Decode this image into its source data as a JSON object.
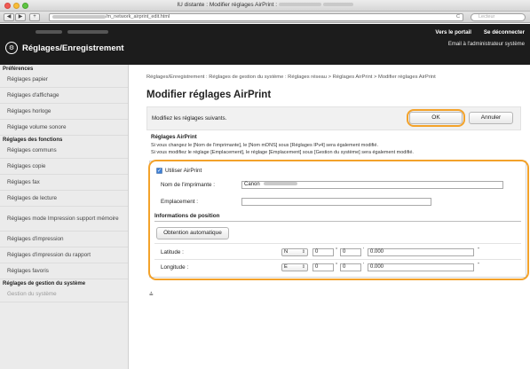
{
  "window": {
    "title_prefix": "IU distante : Modifier réglages AirPrint :",
    "address": "/m_network_airprint_edit.html",
    "reload_icon": "C",
    "search_placeholder": "Lecteur",
    "back_icon": "◀",
    "forward_icon": "▶",
    "add_icon": "+"
  },
  "header": {
    "portal_link": "Vers le portail",
    "logout_link": "Se déconnecter",
    "email_link": "Email à l'administrateur système",
    "app_title": "Réglages/Enregistrement",
    "app_icon": "⚙"
  },
  "sidebar": {
    "sections": [
      {
        "heading": "Préférences",
        "items": [
          {
            "label": "Réglages papier",
            "height": 18
          },
          {
            "label": "Réglages d'affichage",
            "height": 18
          },
          {
            "label": "Réglages horloge",
            "height": 18
          },
          {
            "label": "Réglage volume sonore",
            "height": 18
          }
        ]
      },
      {
        "heading": "Réglages des fonctions",
        "items": [
          {
            "label": "Réglages communs",
            "height": 18
          },
          {
            "label": "Réglages copie",
            "height": 18
          },
          {
            "label": "Réglages fax",
            "height": 18
          },
          {
            "label": "Réglages de lecture",
            "height": 18
          },
          {
            "label": "Réglages mode Impression support mémoire",
            "height": 28
          },
          {
            "label": "Réglages d'impression",
            "height": 18
          },
          {
            "label": "Réglages d'impression du rapport",
            "height": 18
          },
          {
            "label": "Réglages favoris",
            "height": 18
          }
        ]
      },
      {
        "heading": "Réglages de gestion du système",
        "items": [
          {
            "label": "Gestion du système",
            "height": 18,
            "dim": true
          }
        ]
      }
    ]
  },
  "main": {
    "breadcrumb": "Réglages/Enregistrement : Réglages de gestion du système : Réglages réseau > Réglages AirPrint > Modifier réglages AirPrint",
    "title": "Modifier réglages AirPrint",
    "prompt": "Modifiez les réglages suivants.",
    "ok_label": "OK",
    "cancel_label": "Annuler",
    "section_title": "Réglages AirPrint",
    "note1": "Si vous changez le [Nom de l'imprimante], le [Nom mDNS] sous [Réglages IPv4] sera également modifié.",
    "note2": "Si vous modifiez le réglage [Emplacement], le réglage [Emplacement] sous [Gestion du système] sera également modifié.",
    "use_airprint_label": "Utiliser AirPrint",
    "use_airprint_checked": true,
    "printer_name_label": "Nom de l'imprimante :",
    "printer_name_value": "Canon",
    "location_label": "Emplacement :",
    "location_value": "",
    "position_heading": "Informations de position",
    "auto_btn_label": "Obtention automatique",
    "latitude": {
      "label": "Latitude :",
      "hemisphere": "N",
      "degrees": "0",
      "minutes": "0",
      "seconds": "0.000",
      "deg_unit": "°",
      "min_unit": "'",
      "sec_unit": "\""
    },
    "longitude": {
      "label": "Longitude :",
      "hemisphere": "E",
      "degrees": "0",
      "minutes": "0",
      "seconds": "0.000",
      "deg_unit": "°",
      "min_unit": "'",
      "sec_unit": "\""
    },
    "page_top_icon": "⩮"
  },
  "colors": {
    "highlight": "#f3a22a",
    "header_bg": "#1c1c1c",
    "sidebar_bg": "#ebebeb"
  }
}
